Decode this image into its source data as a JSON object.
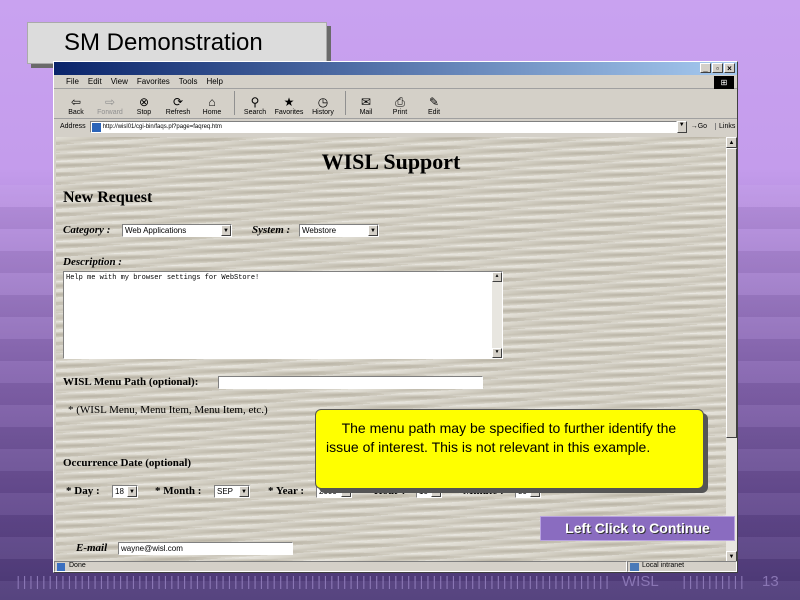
{
  "slide": {
    "title": "SM Demonstration",
    "callout": "The menu path may be specified to further identify the issue of interest. This is not relevant in this example.",
    "continue_label": "Left Click to Continue",
    "footer_label": "WISL",
    "page_number": "13"
  },
  "browser": {
    "title_controls": [
      "_",
      "▫",
      "×"
    ],
    "menu": [
      "File",
      "Edit",
      "View",
      "Favorites",
      "Tools",
      "Help"
    ],
    "toolbar": [
      {
        "label": "Back",
        "icon": "back-arrow-icon",
        "glyph": "⇦",
        "enabled": true
      },
      {
        "label": "Forward",
        "icon": "forward-arrow-icon",
        "glyph": "⇨",
        "enabled": false
      },
      {
        "label": "Stop",
        "icon": "stop-icon",
        "glyph": "⊗",
        "enabled": true
      },
      {
        "label": "Refresh",
        "icon": "refresh-icon",
        "glyph": "⟳",
        "enabled": true
      },
      {
        "label": "Home",
        "icon": "home-icon",
        "glyph": "⌂",
        "enabled": true
      },
      {
        "label": "Search",
        "icon": "search-icon",
        "glyph": "⚲",
        "enabled": true
      },
      {
        "label": "Favorites",
        "icon": "favorites-icon",
        "glyph": "★",
        "enabled": true
      },
      {
        "label": "History",
        "icon": "history-icon",
        "glyph": "◷",
        "enabled": true
      },
      {
        "label": "Mail",
        "icon": "mail-icon",
        "glyph": "✉",
        "enabled": true
      },
      {
        "label": "Print",
        "icon": "print-icon",
        "glyph": "⎙",
        "enabled": true
      },
      {
        "label": "Edit",
        "icon": "edit-icon",
        "glyph": "✎",
        "enabled": true
      }
    ],
    "address_label": "Address",
    "url": "http://wisl01/cgi-bin/faqs.pl?page=faqreq.htm",
    "go_label": "Go",
    "links_label": "Links",
    "status_text": "Done",
    "zone_text": "Local intranet"
  },
  "form": {
    "page_title": "WISL Support",
    "section_title": "New Request",
    "category_label": "Category :",
    "category_value": "Web Applications",
    "system_label": "System :",
    "system_value": "Webstore",
    "description_label": "Description :",
    "description_value": "Help me with my browser settings for WebStore!",
    "menu_path_label": "WISL Menu Path (optional):",
    "menu_path_value": "",
    "menu_path_note": "* (WISL Menu, Menu Item, Menu Item, etc.)",
    "occurrence_label": "Occurrence Date (optional)",
    "day_label": "* Day :",
    "day_value": "18",
    "month_label": "* Month :",
    "month_value": "SEP",
    "year_label": "* Year :",
    "year_value": "2000",
    "hour_label": "Hour :",
    "hour_value": "10",
    "minute_label": "Minute :",
    "minute_value": "30",
    "email_label": "E-mail",
    "email_value": "wayne@wisl.com"
  }
}
